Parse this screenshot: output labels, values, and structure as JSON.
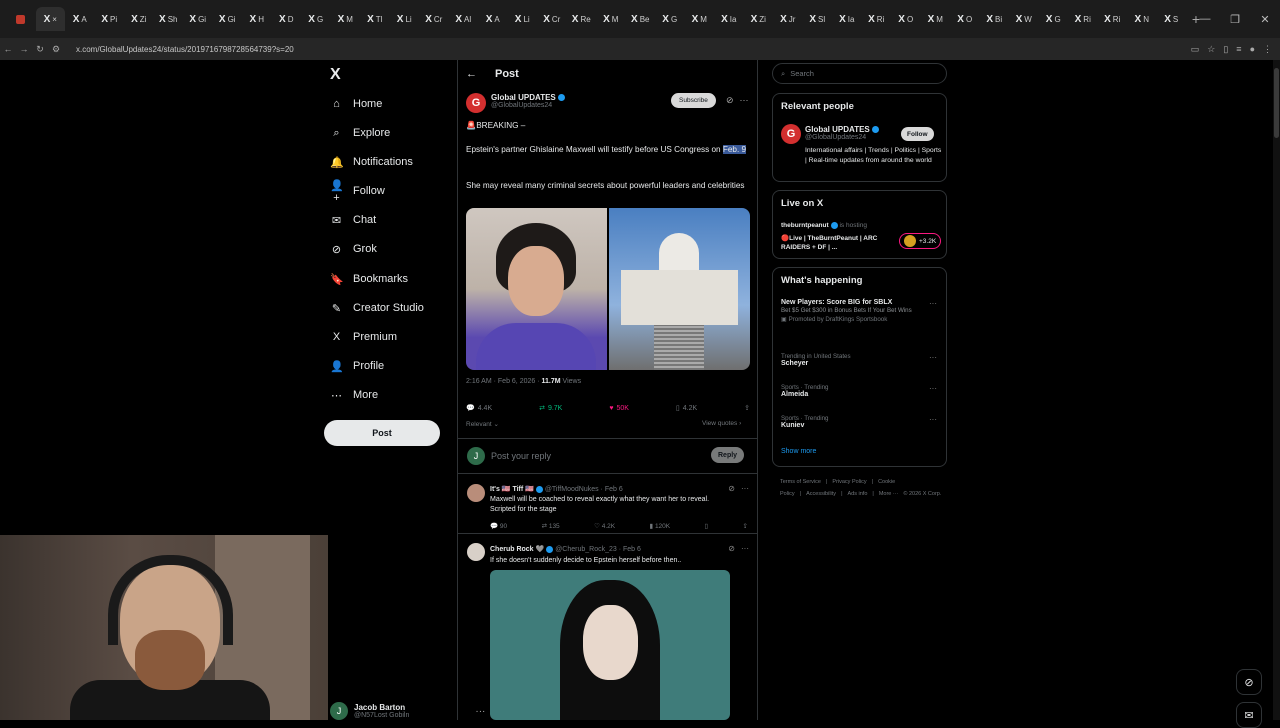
{
  "browser": {
    "tabs": [
      "A",
      "Pi",
      "Zi",
      "Sh",
      "Gi",
      "Gi",
      "H",
      "D",
      "G",
      "M",
      "Tl",
      "Li",
      "Cr",
      "Al",
      "A",
      "Li",
      "Cr",
      "Re",
      "M",
      "Be",
      "G",
      "M",
      "Ia",
      "Zi",
      "Jr",
      "Sl",
      "Ia",
      "Ri",
      "O",
      "M",
      "O",
      "Bi",
      "W",
      "G",
      "Ri",
      "Ri",
      "N",
      "S"
    ],
    "url": "x.com/GlobalUpdates24/status/2019716798728564739?s=20"
  },
  "nav": {
    "logo": "X",
    "items": [
      "Home",
      "Explore",
      "Notifications",
      "Follow",
      "Chat",
      "Grok",
      "Bookmarks",
      "Creator Studio",
      "Premium",
      "Profile",
      "More"
    ],
    "post_button": "Post"
  },
  "account": {
    "initial": "J",
    "name": "Jacob Barton",
    "handle": "@N57Lost Gobiln"
  },
  "header": {
    "title": "Post"
  },
  "tweet": {
    "avatar": "G",
    "name": "Global UPDATES",
    "handle": "@GlobalUpdates24",
    "subscribe": "Subscribe",
    "line1": "🚨BREAKING –",
    "line2a": "Epstein's partner Ghislaine Maxwell will testify before US Congress on ",
    "line2b": "Feb. 9",
    "line3": "She may reveal many criminal secrets about powerful leaders and celebrities",
    "time": "2:16 AM · Feb 6, 2026 · ",
    "views": "11.7M",
    "views_label": " Views",
    "replies": "4.4K",
    "reposts": "9.7K",
    "likes": "50K",
    "bookmarks": "4.2K",
    "relevant": "Relevant ⌄",
    "view_quotes": "View quotes ›"
  },
  "reply_box": {
    "initial": "J",
    "placeholder": "Post your reply",
    "button": "Reply"
  },
  "comments": [
    {
      "name": "It's 🇺🇸 Tiff 🇺🇸",
      "meta": "@TiffMoodNukes · Feb 6",
      "text": "Maxwell will be coached to reveal exactly what they want her to reveal. Scripted for the stage",
      "replies": "90",
      "reposts": "135",
      "likes": "4.2K",
      "views": "120K"
    },
    {
      "name": "Cherub Rock 🩶",
      "meta": "@Cherub_Rock_23 · Feb 6",
      "text": "If she doesn't suddenly decide to Epstein herself before then.."
    }
  ],
  "sidebar": {
    "search_placeholder": "Search",
    "relevant_title": "Relevant people",
    "person": {
      "name": "Global UPDATES",
      "handle": "@GlobalUpdates24",
      "follow": "Follow",
      "bio": "International affairs | Trends | Politics | Sports | Real-time updates from around the world"
    },
    "live_title": "Live on X",
    "live": {
      "host": "theburntpeanut",
      "status": "is hosting",
      "title": "🔴Live | TheBurntPeanut | ARC RAIDERS + DF | ...",
      "count": "+3.2K"
    },
    "happening_title": "What's happening",
    "trends": [
      {
        "title": "New Players: Score BIG for SBLX",
        "desc": "Bet $5 Get $300 in Bonus Bets If Your Bet Wins",
        "promo": "Promoted by DraftKings Sportsbook"
      },
      {
        "cat": "Trending in United States",
        "title": "Scheyer"
      },
      {
        "cat": "Sports · Trending",
        "title": "Almeida"
      },
      {
        "cat": "Sports · Trending",
        "title": "Kuniev"
      }
    ],
    "show_more": "Show more",
    "footer": [
      "Terms of Service",
      "|",
      "Privacy Policy",
      "|",
      "Cookie Policy",
      "|",
      "Accessibility",
      "|",
      "Ads info",
      "|",
      "More ···",
      "© 2026 X Corp."
    ]
  }
}
